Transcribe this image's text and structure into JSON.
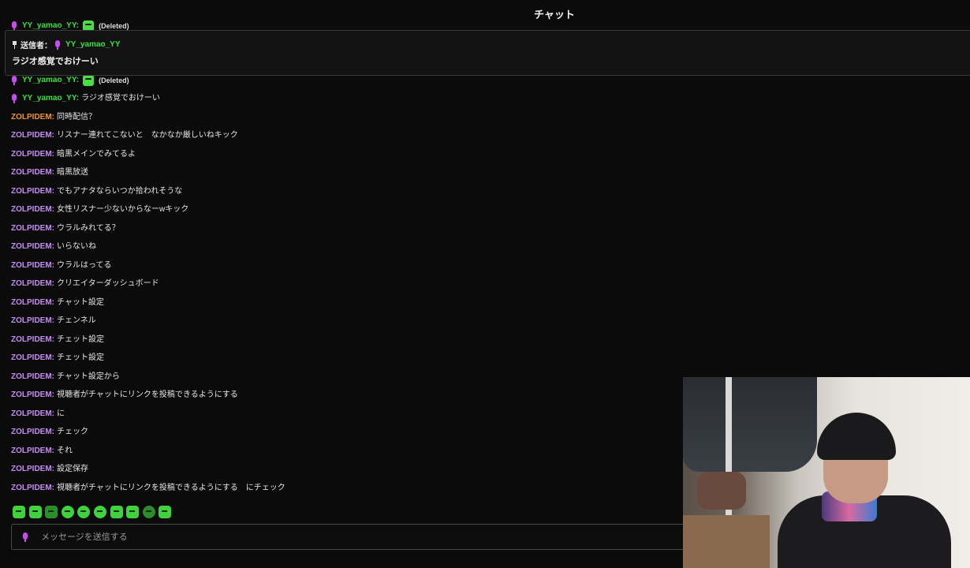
{
  "header": {
    "title": "チャット"
  },
  "pinned": {
    "sender_label": "送信者：",
    "sender_name": "YY_yamao_YY",
    "text": "ラジオ感覚でおけーい"
  },
  "messages": [
    {
      "user": "YY_yamao_YY:",
      "text": "(Deleted)"
    },
    {
      "user": "YY_yamao_YY:",
      "text": "ラジオ感覚でおけーい"
    },
    {
      "user": "ZOLPIDEM:",
      "text": "同時配信？"
    },
    {
      "user": "ZOLPIDEM:",
      "text": "リスナー連れてこないと　なかなか厳しいねキック"
    },
    {
      "user": "ZOLPIDEM:",
      "text": "暗黒メインでみてるよ"
    },
    {
      "user": "ZOLPIDEM:",
      "text": "暗黒放送"
    },
    {
      "user": "ZOLPIDEM:",
      "text": "でもアナタならいつか拾われそうな"
    },
    {
      "user": "ZOLPIDEM:",
      "text": "女性リスナー少ないからなーwキック"
    },
    {
      "user": "ZOLPIDEM:",
      "text": "ウラルみれてる？"
    },
    {
      "user": "ZOLPIDEM:",
      "text": "いらないね"
    },
    {
      "user": "ZOLPIDEM:",
      "text": "ウラルはってる"
    },
    {
      "user": "ZOLPIDEM:",
      "text": "クリエイターダッシュボード"
    },
    {
      "user": "ZOLPIDEM:",
      "text": "チャット設定"
    },
    {
      "user": "ZOLPIDEM:",
      "text": "チェンネル"
    },
    {
      "user": "ZOLPIDEM:",
      "text": "チェット設定"
    },
    {
      "user": "ZOLPIDEM:",
      "text": "チェット設定"
    },
    {
      "user": "ZOLPIDEM:",
      "text": "チャット設定から"
    },
    {
      "user": "ZOLPIDEM:",
      "text": "視聴者がチャットにリンクを投稿できるようにする"
    },
    {
      "user": "ZOLPIDEM:",
      "text": "に"
    },
    {
      "user": "ZOLPIDEM:",
      "text": "チェック"
    },
    {
      "user": "ZOLPIDEM:",
      "text": "それ"
    },
    {
      "user": "ZOLPIDEM:",
      "text": "設定保存"
    },
    {
      "user": "ZOLPIDEM:",
      "text": "視聴者がチャットにリンクを投稿できるようにする　にチェック"
    }
  ],
  "colors": {
    "zolpidem": "#c58cf2",
    "highlight": "#f0912f",
    "yy": "#38e03b",
    "mic": "#c84cf0"
  },
  "emotes": [
    "emote-1",
    "emote-2",
    "emote-3",
    "emote-4",
    "emote-5",
    "emote-6",
    "emote-7",
    "emote-8",
    "emote-9",
    "emote-10"
  ],
  "input": {
    "placeholder": "メッセージを送信する"
  }
}
